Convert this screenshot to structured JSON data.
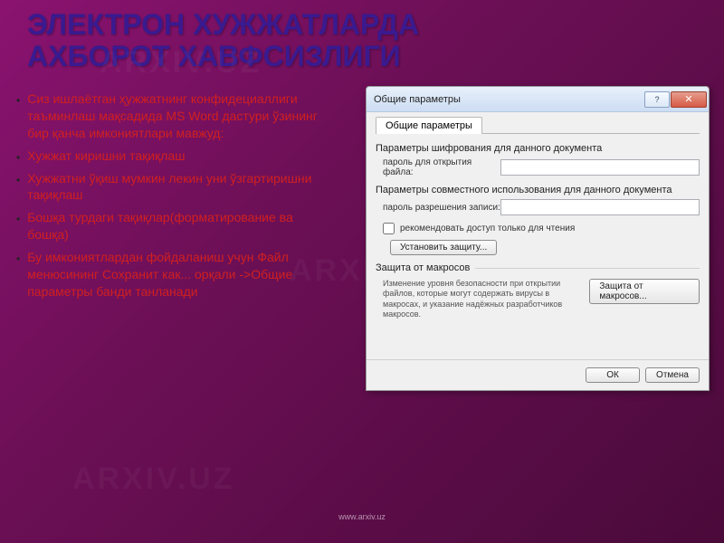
{
  "watermark": "ARXIV.UZ",
  "header": {
    "title_line1": "ЭЛЕКТРОН ХУЖЖАТЛАРДА",
    "title_line2": "АХБОРОТ ХАВФСИЗЛИГИ"
  },
  "bullets": [
    "Сиз ишлаётган ҳужжатнинг конфидециаллиги таъминлаш мақсадида MS Word дастури ўзининг бир қанча имкониятлари мавжуд:",
    "Хужжат киришни тақиқлаш",
    "Хужжатни ўқиш мумкин лекин уни ўзгартиришни тақиқлаш",
    "Бошқа турдаги тақиқлар(форматирование ва бошқа)",
    "Бу имкониятлардан фойдаланиш учун Файл менюсининг Сохранит как... орқали ->Общие параметры банди танланади"
  ],
  "footer_url": "www.arxiv.uz",
  "dialog": {
    "title": "Общие параметры",
    "help_glyph": "?",
    "close_glyph": "✕",
    "tab_label": "Общие параметры",
    "group1_label": "Параметры шифрования для данного документа",
    "field1_label": "пароль для открытия файла:",
    "group2_label": "Параметры совместного использования для данного документа",
    "field2_label": "пароль разрешения записи:",
    "checkbox_label": "рекомендовать доступ только для чтения",
    "protect_button": "Установить защиту...",
    "macro_section_label": "Защита от макросов",
    "macro_info": "Изменение уровня безопасности при открытии файлов, которые могут содержать вирусы в макросах, и указание надёжных разработчиков макросов.",
    "macro_button": "Защита от макросов...",
    "ok_label": "ОК",
    "cancel_label": "Отмена"
  }
}
